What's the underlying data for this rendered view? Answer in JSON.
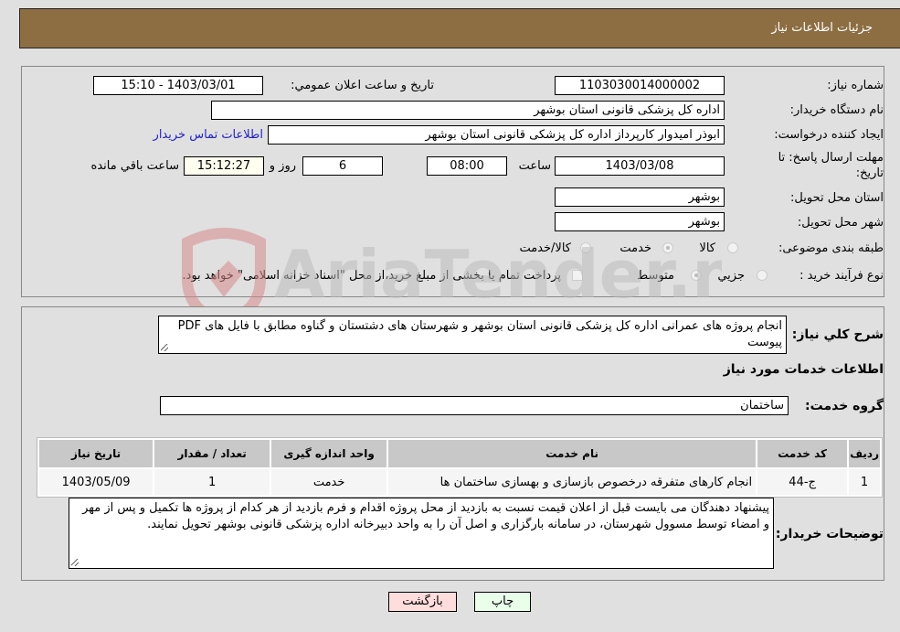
{
  "header": {
    "title": "جزئیات اطلاعات نیاز"
  },
  "form": {
    "need_number_label": "شماره نیاز:",
    "need_number": "1103030014000002",
    "announce_label": "تاریخ و ساعت اعلان عمومي:",
    "announce_value": "1403/03/01 - 15:10",
    "buyer_label": "نام دستگاه خریدار:",
    "buyer_value": "اداره کل پزشکی قانونی استان بوشهر",
    "creator_label": "ایجاد کننده درخواست:",
    "creator_value": "ابوذر امیدوار کارپرداز اداره کل پزشکی قانونی استان بوشهر",
    "contact_link": "اطلاعات تماس خریدار",
    "deadline_label_1": "مهلت ارسال پاسخ: تا",
    "deadline_label_2": "تاریخ:",
    "deadline_date": "1403/03/08",
    "time_label": "ساعت",
    "deadline_time": "08:00",
    "days_value": "6",
    "days_label": "روز و",
    "remaining_time": "15:12:27",
    "remaining_label": "ساعت باقي مانده",
    "province_label": "استان محل تحویل:",
    "province_value": "بوشهر",
    "city_label": "شهر محل تحویل:",
    "city_value": "بوشهر",
    "category_label": "طبقه بندی موضوعی:",
    "category_options": [
      "کالا",
      "خدمت",
      "کالا/خدمت"
    ],
    "category_selected": "خدمت",
    "process_label": "نوع فرآیند خرید :",
    "process_options": [
      "جزيي",
      "متوسط"
    ],
    "process_selected": "متوسط",
    "treasury_text": "پرداخت تمام یا بخشی از مبلغ خرید،از محل \"اسناد خزانه اسلامی\" خواهد بود."
  },
  "details": {
    "summary_label": "شرح كلي نياز:",
    "summary_text": "انجام پروژه های عمرانی اداره کل پزشکی قانونی استان بوشهر و شهرستان های دشتستان و گناوه مطابق با فایل های PDF پیوست",
    "services_heading": "اطلاعات خدمات مورد نیاز",
    "service_group_label": "گروه خدمت:",
    "service_group_value": "ساختمان",
    "table": {
      "headers": [
        "ردیف",
        "کد خدمت",
        "نام خدمت",
        "واحد اندازه گیری",
        "تعداد / مقدار",
        "تاریخ نیاز"
      ],
      "rows": [
        [
          "1",
          "ج-44",
          "انجام کارهای متفرقه درخصوص بازسازی و بهسازی ساختمان ها",
          "خدمت",
          "1",
          "1403/05/09"
        ]
      ]
    },
    "buyer_notes_label": "توضیحات خریدار:",
    "buyer_notes_text": "پیشنهاد دهندگان می بایست قبل از اعلان قیمت نسبت به بازدید از محل پروژه اقدام و فرم بازدید از هر کدام از پروژه ها تکمیل و پس از مهر و امضاء توسط مسوول شهرستان، در سامانه بارگزاری و اصل آن را به واحد دبیرخانه اداره پزشکی قانونی بوشهر تحویل نمایند."
  },
  "buttons": {
    "print": "چاپ",
    "back": "بازگشت"
  },
  "watermark": {
    "text": "AriaTender.neT"
  },
  "colors": {
    "header_bg": "#8d6e43",
    "print_bg": "#eaffea",
    "back_bg": "#ffdddd",
    "link": "#2222cc"
  }
}
